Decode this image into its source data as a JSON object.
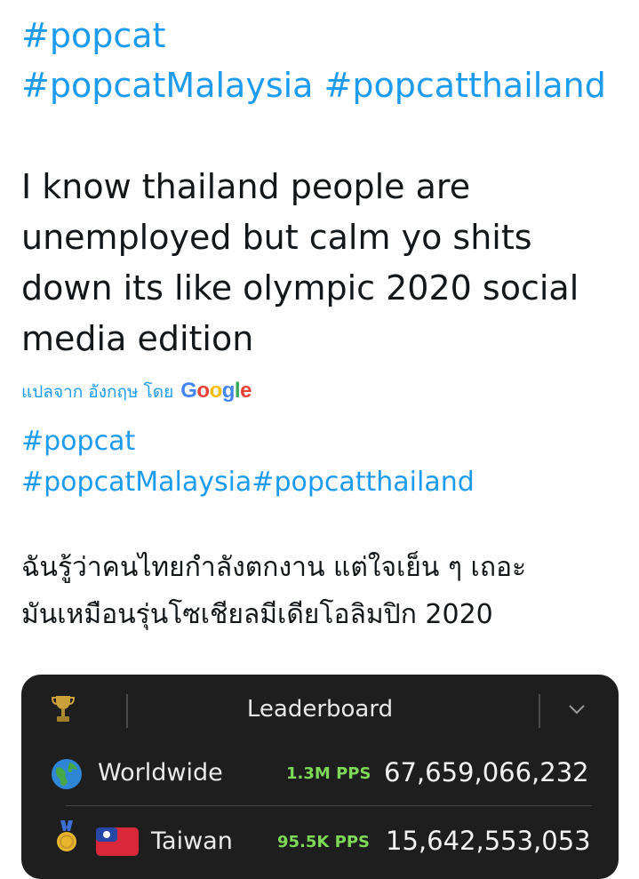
{
  "original": {
    "hashtag_1": "#popcat",
    "hashtag_2": "#popcatMalaysia #popcatthailand",
    "text_lines": [
      "I know thailand people are",
      "unemployed but calm yo shits",
      "down its like olympic 2020 social",
      "media edition"
    ]
  },
  "translation_notice": {
    "text": "แปลจาก อังกฤษ โดย",
    "brand": "Google"
  },
  "translated": {
    "hashtag_1": "#popcat",
    "hashtag_2": "#popcatMalaysia#popcatthailand",
    "text_lines": [
      "ฉันรู้ว่าคนไทยกำลังตกงาน แต่ใจเย็น ๆ เถอะ",
      "มันเหมือนรุ่นโซเชียลมีเดียโอลิมปิก 2020"
    ]
  },
  "leaderboard": {
    "title": "Leaderboard",
    "rows": [
      {
        "name": "Worldwide",
        "pps": "1.3M PPS",
        "count": "67,659,066,232",
        "icon": "globe-icon"
      },
      {
        "name": "Taiwan",
        "pps": "95.5K PPS",
        "count": "15,642,553,053",
        "icon": "gold-medal-icon"
      }
    ]
  },
  "colors": {
    "link": "#1d9bf0",
    "pps_green": "#7dd957",
    "panel_bg": "#1e1e1e"
  }
}
